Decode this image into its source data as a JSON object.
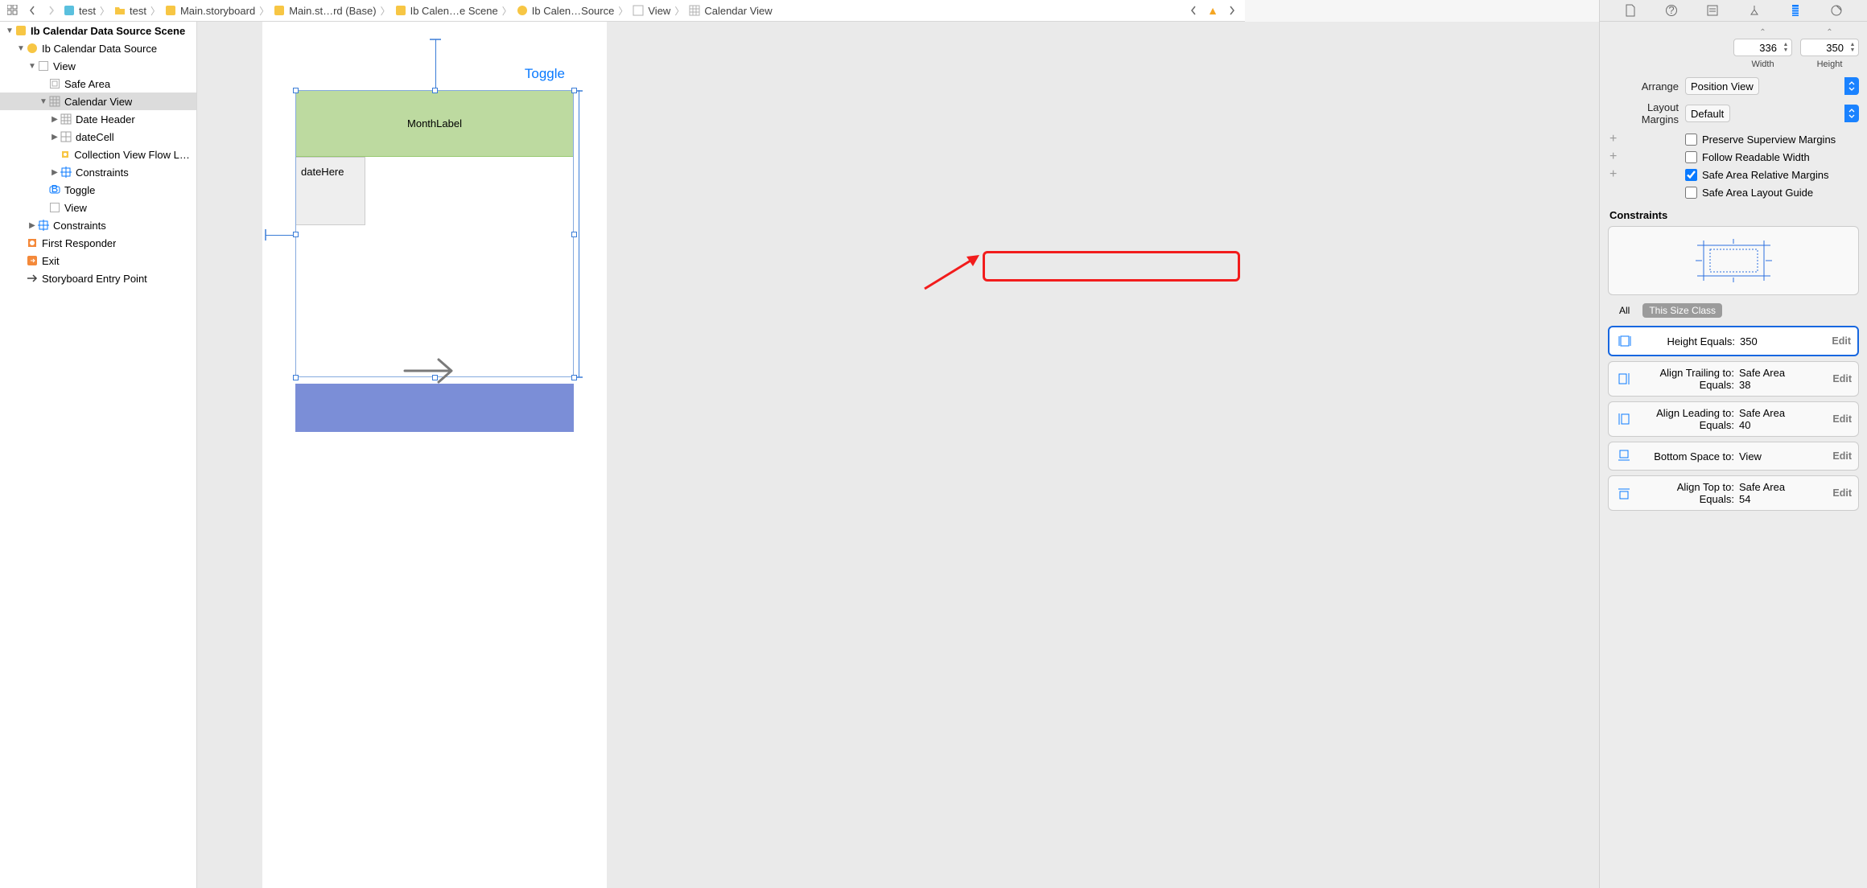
{
  "breadcrumb": {
    "items": [
      {
        "label": "test",
        "icon": "swift-file"
      },
      {
        "label": "test",
        "icon": "folder"
      },
      {
        "label": "Main.storyboard",
        "icon": "storyboard"
      },
      {
        "label": "Main.st…rd (Base)",
        "icon": "storyboard"
      },
      {
        "label": "Ib Calen…e Scene",
        "icon": "scene"
      },
      {
        "label": "Ib Calen…Source",
        "icon": "scene"
      },
      {
        "label": "View",
        "icon": "view"
      },
      {
        "label": "Calendar View",
        "icon": "calendar"
      }
    ]
  },
  "outline": {
    "rows": [
      {
        "indent": 0,
        "disc": "▼",
        "icon": "scene",
        "label": "Ib Calendar Data Source Scene",
        "bold": true
      },
      {
        "indent": 1,
        "disc": "▼",
        "icon": "vc",
        "label": "Ib Calendar Data Source"
      },
      {
        "indent": 2,
        "disc": "▼",
        "icon": "view",
        "label": "View"
      },
      {
        "indent": 3,
        "disc": "",
        "icon": "safearea",
        "label": "Safe Area"
      },
      {
        "indent": 3,
        "disc": "▼",
        "icon": "calendar",
        "label": "Calendar View",
        "hi": true
      },
      {
        "indent": 4,
        "disc": "▶",
        "icon": "calendar",
        "label": "Date Header"
      },
      {
        "indent": 4,
        "disc": "▶",
        "icon": "cell",
        "label": "dateCell"
      },
      {
        "indent": 4,
        "disc": "",
        "icon": "flow",
        "label": "Collection View Flow Lay…"
      },
      {
        "indent": 4,
        "disc": "▶",
        "icon": "constraints",
        "label": "Constraints"
      },
      {
        "indent": 3,
        "disc": "",
        "icon": "button",
        "label": "Toggle"
      },
      {
        "indent": 3,
        "disc": "",
        "icon": "view",
        "label": "View"
      },
      {
        "indent": 2,
        "disc": "▶",
        "icon": "constraints",
        "label": "Constraints"
      },
      {
        "indent": 1,
        "disc": "",
        "icon": "first",
        "label": "First Responder"
      },
      {
        "indent": 1,
        "disc": "",
        "icon": "exit",
        "label": "Exit"
      },
      {
        "indent": 1,
        "disc": "",
        "icon": "entry",
        "label": "Storyboard Entry Point"
      }
    ]
  },
  "canvas": {
    "toggle": "Toggle",
    "month": "MonthLabel",
    "cell": "dateHere"
  },
  "inspector": {
    "width_value": "336",
    "height_value": "350",
    "width_label": "Width",
    "height_label": "Height",
    "arrange_label": "Arrange",
    "arrange_value": "Position View",
    "margins_label": "Layout Margins",
    "margins_value": "Default",
    "chk_preserve": "Preserve Superview Margins",
    "chk_readable": "Follow Readable Width",
    "chk_safearea": "Safe Area Relative Margins",
    "chk_safeguide": "Safe Area Layout Guide",
    "constraints_label": "Constraints",
    "tab_all": "All",
    "tab_this": "This Size Class",
    "edit_label": "Edit",
    "constraints": [
      {
        "k1": "Height Equals:",
        "v1": "350",
        "k2": "",
        "v2": ""
      },
      {
        "k1": "Align Trailing to:",
        "v1": "Safe Area",
        "k2": "Equals:",
        "v2": "38"
      },
      {
        "k1": "Align Leading to:",
        "v1": "Safe Area",
        "k2": "Equals:",
        "v2": "40"
      },
      {
        "k1": "Bottom Space to:",
        "v1": "View",
        "k2": "",
        "v2": ""
      },
      {
        "k1": "Align Top to:",
        "v1": "Safe Area",
        "k2": "Equals:",
        "v2": "54"
      }
    ]
  }
}
